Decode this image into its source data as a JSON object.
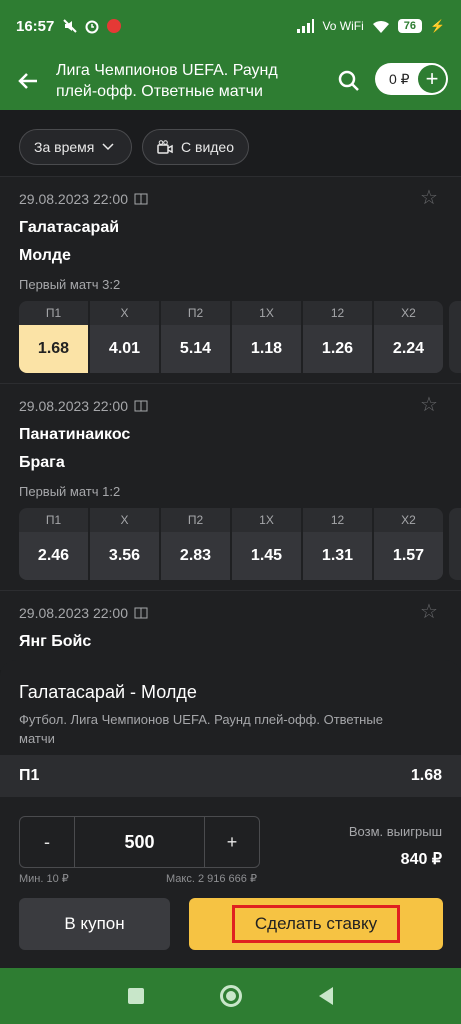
{
  "status_bar": {
    "time": "16:57",
    "signal_text": "Vo WiFi",
    "battery": "76"
  },
  "header": {
    "title": "Лига Чемпионов UEFA. Раунд плей-офф. Ответные матчи",
    "balance": "0 ₽"
  },
  "filters": {
    "time_label": "За время",
    "video_label": "С видео"
  },
  "markets": [
    "П1",
    "X",
    "П2",
    "1X",
    "12",
    "X2"
  ],
  "matches": [
    {
      "date": "29.08.2023 22:00",
      "team1": "Галатасарай",
      "team2": "Молде",
      "first_match": "Первый матч 3:2",
      "odds": [
        "1.68",
        "4.01",
        "5.14",
        "1.18",
        "1.26",
        "2.24"
      ]
    },
    {
      "date": "29.08.2023 22:00",
      "team1": "Панатинаикос",
      "team2": "Брага",
      "first_match": "Первый матч 1:2",
      "odds": [
        "2.46",
        "3.56",
        "2.83",
        "1.45",
        "1.31",
        "1.57"
      ]
    },
    {
      "date": "29.08.2023 22:00",
      "team1": "Янг Бойс",
      "team2": "",
      "first_match": "",
      "odds": []
    }
  ],
  "slip": {
    "title": "Галатасарай - Молде",
    "subtitle": "Футбол. Лига Чемпионов UEFA. Раунд плей-офф. Ответные матчи",
    "pick": "П1",
    "pick_odds": "1.68",
    "minus": "-",
    "plus": "+",
    "stake": "500",
    "min": "Мин. 10 ₽",
    "max": "Макс. 2 916 666 ₽",
    "win_label": "Возм. выигрыш",
    "win_value": "840 ₽",
    "coupon_btn": "В купон",
    "bet_btn": "Сделать ставку"
  }
}
